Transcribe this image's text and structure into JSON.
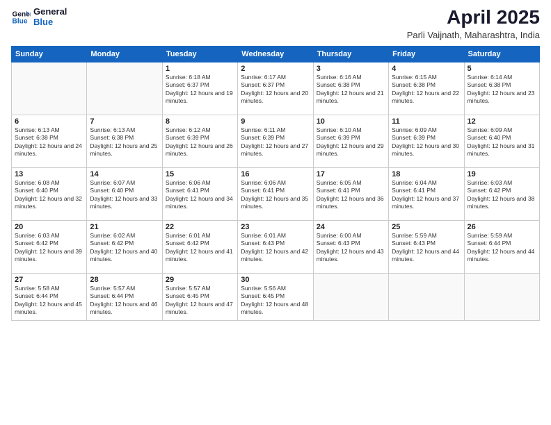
{
  "header": {
    "logo_line1": "General",
    "logo_line2": "Blue",
    "month": "April 2025",
    "location": "Parli Vaijnath, Maharashtra, India"
  },
  "weekdays": [
    "Sunday",
    "Monday",
    "Tuesday",
    "Wednesday",
    "Thursday",
    "Friday",
    "Saturday"
  ],
  "weeks": [
    [
      {
        "day": "",
        "info": ""
      },
      {
        "day": "",
        "info": ""
      },
      {
        "day": "1",
        "info": "Sunrise: 6:18 AM\nSunset: 6:37 PM\nDaylight: 12 hours and 19 minutes."
      },
      {
        "day": "2",
        "info": "Sunrise: 6:17 AM\nSunset: 6:37 PM\nDaylight: 12 hours and 20 minutes."
      },
      {
        "day": "3",
        "info": "Sunrise: 6:16 AM\nSunset: 6:38 PM\nDaylight: 12 hours and 21 minutes."
      },
      {
        "day": "4",
        "info": "Sunrise: 6:15 AM\nSunset: 6:38 PM\nDaylight: 12 hours and 22 minutes."
      },
      {
        "day": "5",
        "info": "Sunrise: 6:14 AM\nSunset: 6:38 PM\nDaylight: 12 hours and 23 minutes."
      }
    ],
    [
      {
        "day": "6",
        "info": "Sunrise: 6:13 AM\nSunset: 6:38 PM\nDaylight: 12 hours and 24 minutes."
      },
      {
        "day": "7",
        "info": "Sunrise: 6:13 AM\nSunset: 6:38 PM\nDaylight: 12 hours and 25 minutes."
      },
      {
        "day": "8",
        "info": "Sunrise: 6:12 AM\nSunset: 6:39 PM\nDaylight: 12 hours and 26 minutes."
      },
      {
        "day": "9",
        "info": "Sunrise: 6:11 AM\nSunset: 6:39 PM\nDaylight: 12 hours and 27 minutes."
      },
      {
        "day": "10",
        "info": "Sunrise: 6:10 AM\nSunset: 6:39 PM\nDaylight: 12 hours and 29 minutes."
      },
      {
        "day": "11",
        "info": "Sunrise: 6:09 AM\nSunset: 6:39 PM\nDaylight: 12 hours and 30 minutes."
      },
      {
        "day": "12",
        "info": "Sunrise: 6:09 AM\nSunset: 6:40 PM\nDaylight: 12 hours and 31 minutes."
      }
    ],
    [
      {
        "day": "13",
        "info": "Sunrise: 6:08 AM\nSunset: 6:40 PM\nDaylight: 12 hours and 32 minutes."
      },
      {
        "day": "14",
        "info": "Sunrise: 6:07 AM\nSunset: 6:40 PM\nDaylight: 12 hours and 33 minutes."
      },
      {
        "day": "15",
        "info": "Sunrise: 6:06 AM\nSunset: 6:41 PM\nDaylight: 12 hours and 34 minutes."
      },
      {
        "day": "16",
        "info": "Sunrise: 6:06 AM\nSunset: 6:41 PM\nDaylight: 12 hours and 35 minutes."
      },
      {
        "day": "17",
        "info": "Sunrise: 6:05 AM\nSunset: 6:41 PM\nDaylight: 12 hours and 36 minutes."
      },
      {
        "day": "18",
        "info": "Sunrise: 6:04 AM\nSunset: 6:41 PM\nDaylight: 12 hours and 37 minutes."
      },
      {
        "day": "19",
        "info": "Sunrise: 6:03 AM\nSunset: 6:42 PM\nDaylight: 12 hours and 38 minutes."
      }
    ],
    [
      {
        "day": "20",
        "info": "Sunrise: 6:03 AM\nSunset: 6:42 PM\nDaylight: 12 hours and 39 minutes."
      },
      {
        "day": "21",
        "info": "Sunrise: 6:02 AM\nSunset: 6:42 PM\nDaylight: 12 hours and 40 minutes."
      },
      {
        "day": "22",
        "info": "Sunrise: 6:01 AM\nSunset: 6:42 PM\nDaylight: 12 hours and 41 minutes."
      },
      {
        "day": "23",
        "info": "Sunrise: 6:01 AM\nSunset: 6:43 PM\nDaylight: 12 hours and 42 minutes."
      },
      {
        "day": "24",
        "info": "Sunrise: 6:00 AM\nSunset: 6:43 PM\nDaylight: 12 hours and 43 minutes."
      },
      {
        "day": "25",
        "info": "Sunrise: 5:59 AM\nSunset: 6:43 PM\nDaylight: 12 hours and 44 minutes."
      },
      {
        "day": "26",
        "info": "Sunrise: 5:59 AM\nSunset: 6:44 PM\nDaylight: 12 hours and 44 minutes."
      }
    ],
    [
      {
        "day": "27",
        "info": "Sunrise: 5:58 AM\nSunset: 6:44 PM\nDaylight: 12 hours and 45 minutes."
      },
      {
        "day": "28",
        "info": "Sunrise: 5:57 AM\nSunset: 6:44 PM\nDaylight: 12 hours and 46 minutes."
      },
      {
        "day": "29",
        "info": "Sunrise: 5:57 AM\nSunset: 6:45 PM\nDaylight: 12 hours and 47 minutes."
      },
      {
        "day": "30",
        "info": "Sunrise: 5:56 AM\nSunset: 6:45 PM\nDaylight: 12 hours and 48 minutes."
      },
      {
        "day": "",
        "info": ""
      },
      {
        "day": "",
        "info": ""
      },
      {
        "day": "",
        "info": ""
      }
    ]
  ]
}
